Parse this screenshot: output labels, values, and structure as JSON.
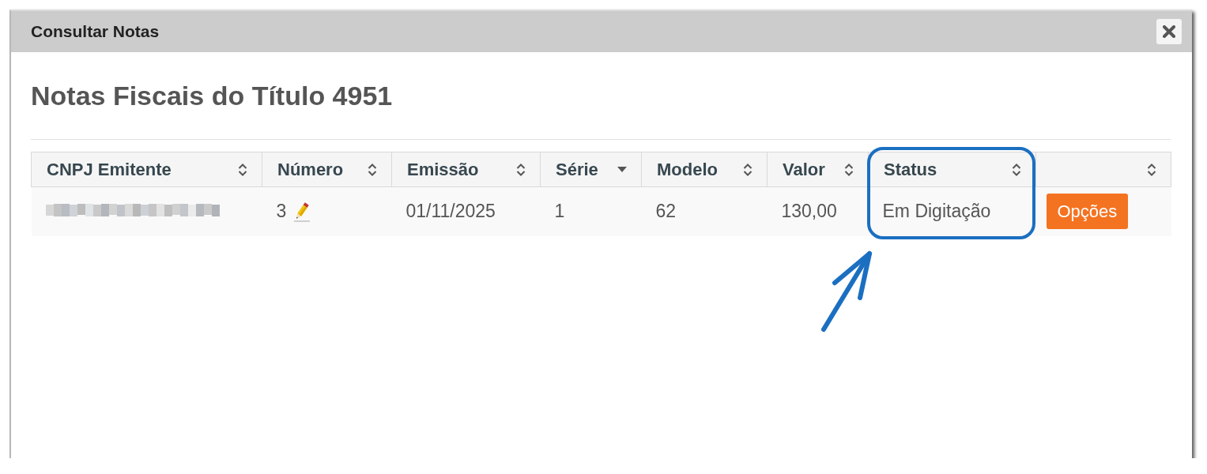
{
  "dialog": {
    "title": "Consultar Notas"
  },
  "heading": "Notas Fiscais do Título 4951",
  "table": {
    "columns": [
      {
        "label": "CNPJ Emitente",
        "sorted_descending": false
      },
      {
        "label": "Número",
        "sorted_descending": false
      },
      {
        "label": "Emissão",
        "sorted_descending": false
      },
      {
        "label": "Série",
        "sorted_descending": true
      },
      {
        "label": "Modelo",
        "sorted_descending": false
      },
      {
        "label": "Valor",
        "sorted_descending": false
      },
      {
        "label": "Status",
        "sorted_descending": false
      },
      {
        "sorted_descending": false
      }
    ],
    "rows": [
      {
        "cnpj_blurred": true,
        "numero": "3",
        "emissao": "01/11/2025",
        "serie": "1",
        "modelo": "62",
        "valor": "130,00",
        "status": "Em Digitação",
        "action": "Opções"
      }
    ]
  }
}
